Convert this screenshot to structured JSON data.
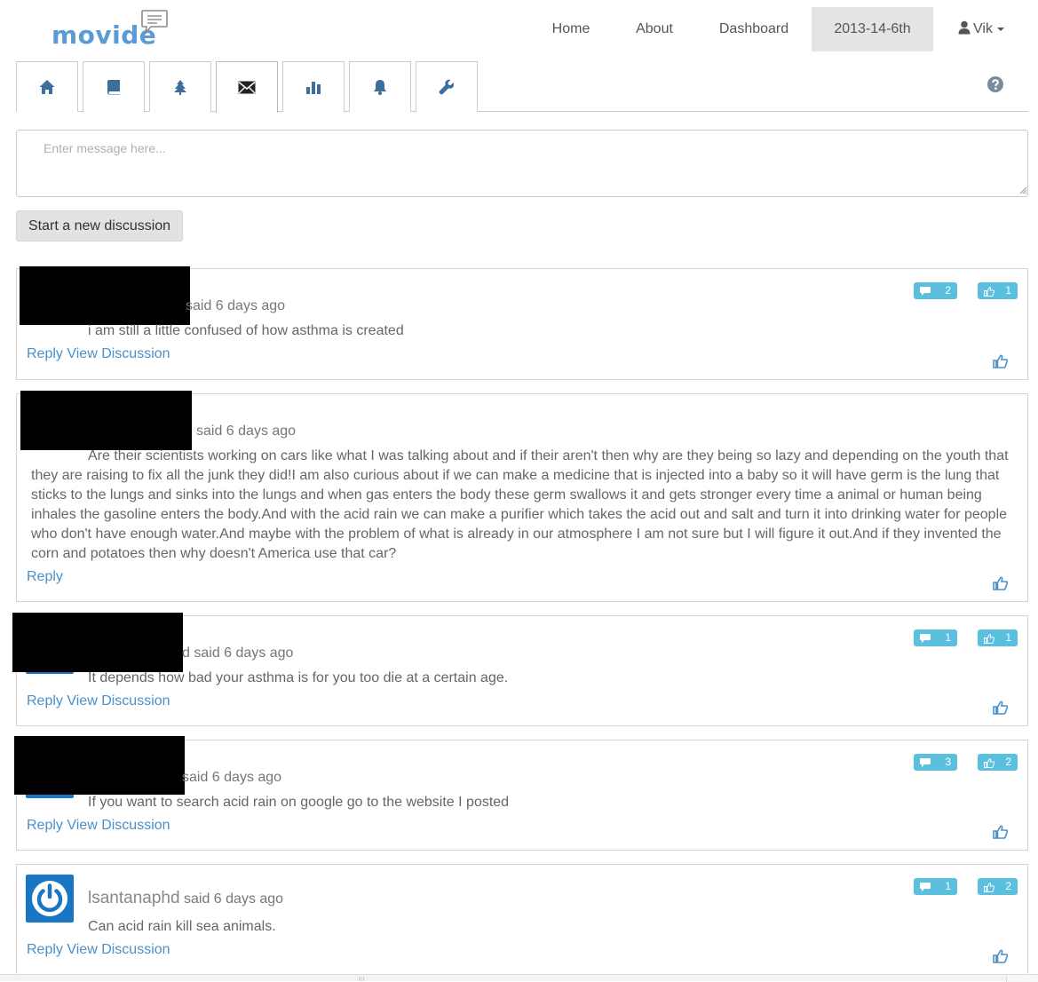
{
  "brand": {
    "name": "movide"
  },
  "nav": {
    "home": "Home",
    "about": "About",
    "dashboard": "Dashboard",
    "date": "2013-14-6th",
    "user": "Vik"
  },
  "tabs": [
    {
      "icon": "home-icon"
    },
    {
      "icon": "book-icon"
    },
    {
      "icon": "tree-icon"
    },
    {
      "icon": "envelope-icon",
      "active": true
    },
    {
      "icon": "bar-chart-icon"
    },
    {
      "icon": "bell-icon"
    },
    {
      "icon": "wrench-icon"
    }
  ],
  "composer": {
    "placeholder": "Enter message here...",
    "button": "Start a new discussion"
  },
  "posts": [
    {
      "author": "",
      "said": "said 6 days ago",
      "body": "i am still a little confused of how asthma is created",
      "reply": "Reply",
      "view": "View Discussion",
      "comments": "2",
      "likes": "1"
    },
    {
      "author": "",
      "said": "said 6 days ago",
      "body": "Are their scientists working on cars like what I was talking about and if their aren't then why are they being so lazy and depending on the youth that they are raising to fix all the junk they did!I am also curious about if we can make a medicine that is injected into a baby so it will have germ is the lung that sticks to the lungs and sinks into the lungs and when gas enters the body these germ swallows it and gets stronger every time a animal or human being inhales the gasoline enters the body.And with the acid rain we can make a purifier which takes the acid out and salt and turn it into drinking water for people who don't have enough water.And maybe with the problem of what is already in our atmosphere I am not sure but I will figure it out.And if they invented the corn and potatoes then why doesn't America use that car?",
      "reply": "Reply"
    },
    {
      "author": "",
      "said_prefix": "d",
      "said": "said 6 days ago",
      "body": "It depends how bad your asthma is for you too die at a certain age.",
      "reply": "Reply",
      "view": "View Discussion",
      "comments": "1",
      "likes": "1"
    },
    {
      "author": "",
      "said": "said 6 days ago",
      "body": "If you want to search acid rain on google go to the website I posted",
      "reply": "Reply",
      "view": "View Discussion",
      "comments": "3",
      "likes": "2"
    },
    {
      "author": "lsantanaphd",
      "said": "said 6 days ago",
      "body": "Can acid rain kill sea animals.",
      "reply": "Reply",
      "view": "View Discussion",
      "comments": "1",
      "likes": "2"
    }
  ],
  "colors": {
    "brand": "#5b9bd5",
    "link": "#4a90c9",
    "badge": "#5bc0de",
    "avatar": "#1976c4",
    "active_nav_bg": "#e4e4e4"
  }
}
